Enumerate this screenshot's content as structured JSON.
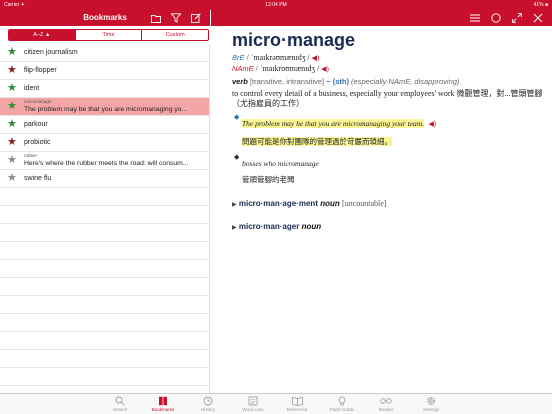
{
  "status": {
    "carrier": "Carrier ✈",
    "time": "12:04 PM",
    "battery": "41% ■"
  },
  "left_header": {
    "title": "Bookmarks"
  },
  "segments": [
    "A–Z ▲",
    "Time",
    "Custom"
  ],
  "bookmarks": [
    {
      "text": "citizen journalism",
      "star": "#2e8b3a"
    },
    {
      "text": "flip-flopper",
      "star": "#8b1a1a"
    },
    {
      "text": "ident",
      "star": "#2e8b3a"
    },
    {
      "sub": "micromanage",
      "text": "The problem may be that you are micromanaging yo...",
      "star": "#2e8b3a",
      "selected": true
    },
    {
      "text": "parkour",
      "star": "#2e8b3a"
    },
    {
      "text": "probiotic",
      "star": "#8b1a1a"
    },
    {
      "sub": "rubber",
      "text": "Here's where the rubber meets the road: will consum...",
      "star": "#888888"
    },
    {
      "text": "swine flu",
      "star": "#888888"
    }
  ],
  "entry": {
    "headword": "micro·manage",
    "bre_label": "BrE",
    "bre_pron": "/ ˈmaɪkrəʊmænɪdʒ /",
    "name_label": "NAmE",
    "name_pron": "/ ˈmaɪkroʊmænɪdʒ /",
    "pos": "verb",
    "grammar": "[transitive, intransitive]",
    "sth": "~ (sth)",
    "usage": "(especially NAmE, disapproving)",
    "definition": "to control every detail of a business, especially your employees' work 微觀管理，對...管頭管腳（尤指雇員的工作）",
    "examples": [
      {
        "en": "The problem may be that you are micromanaging your team.",
        "zh": "問題可能是你對團隊的管理過於苛嚴而瑣細。",
        "highlight": true
      },
      {
        "en": "bosses who micromanage",
        "zh": "管頭管腳的老闆",
        "highlight": false
      }
    ],
    "derivatives": [
      {
        "word": "micro·man·age·ment",
        "pos": "noun",
        "label": "[uncountable]"
      },
      {
        "word": "micro·man·ager",
        "pos": "noun",
        "label": ""
      }
    ]
  },
  "tabs": [
    {
      "label": "Search",
      "icon": "search-icon"
    },
    {
      "label": "Bookmarks",
      "icon": "bookmarks-icon",
      "active": true
    },
    {
      "label": "History",
      "icon": "history-icon"
    },
    {
      "label": "Word Lists",
      "icon": "word-lists-icon"
    },
    {
      "label": "Reference",
      "icon": "reference-icon"
    },
    {
      "label": "Flash Cards",
      "icon": "flash-cards-icon"
    },
    {
      "label": "Reader",
      "icon": "reader-icon"
    },
    {
      "label": "Settings",
      "icon": "settings-icon"
    }
  ],
  "colors": {
    "brand": "#c8102e",
    "highlight": "#fbf595",
    "link": "#2d6fb6",
    "selected_row": "#f4a6a7"
  }
}
